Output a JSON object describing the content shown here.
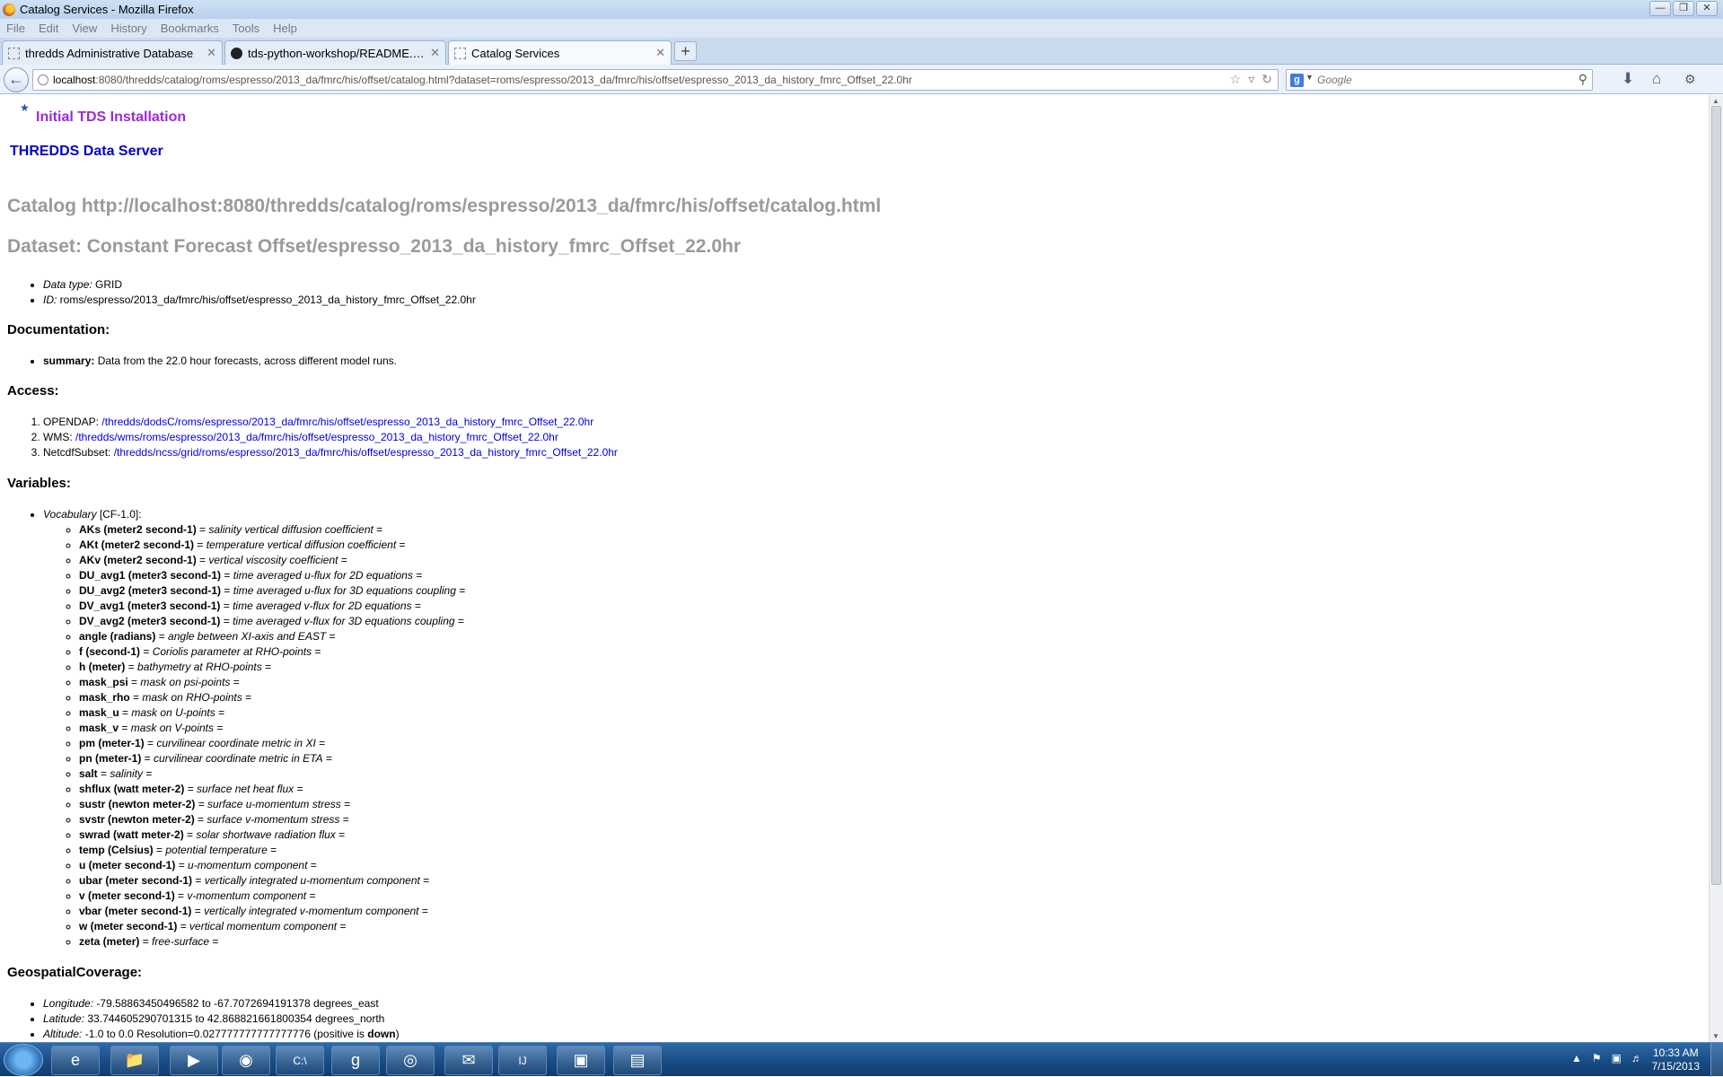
{
  "window": {
    "title": "Catalog Services - Mozilla Firefox",
    "min_icon": "minimize-icon",
    "max_icon": "maximize-icon",
    "close_icon": "close-icon"
  },
  "menu": [
    "File",
    "Edit",
    "View",
    "History",
    "Bookmarks",
    "Tools",
    "Help"
  ],
  "tabs": [
    {
      "label": "thredds Administrative Database",
      "active": false
    },
    {
      "label": "tds-python-workshop/README.org a...",
      "active": false
    },
    {
      "label": "Catalog Services",
      "active": true
    }
  ],
  "new_tab_label": "+",
  "address": {
    "host": "localhost",
    "rest": ":8080/thredds/catalog/roms/espresso/2013_da/fmrc/his/offset/catalog.html?dataset=roms/espresso/2013_da/fmrc/his/offset/espresso_2013_da_history_fmrc_Offset_22.0hr"
  },
  "search": {
    "placeholder": "Google",
    "engine_letter": "g"
  },
  "page": {
    "install_name": "Initial TDS Installation",
    "server_name": "THREDDS Data Server",
    "catalog_title": "Catalog http://localhost:8080/thredds/catalog/roms/espresso/2013_da/fmrc/his/offset/catalog.html",
    "dataset_title": "Dataset: Constant Forecast Offset/espresso_2013_da_history_fmrc_Offset_22.0hr",
    "info": [
      {
        "label": "Data type:",
        "value": " GRID"
      },
      {
        "label": "ID:",
        "value": " roms/espresso/2013_da/fmrc/his/offset/espresso_2013_da_history_fmrc_Offset_22.0hr"
      }
    ],
    "documentation": {
      "heading": "Documentation:",
      "label": "summary:",
      "text": " Data from the 22.0 hour forecasts, across different model runs."
    },
    "access": {
      "heading": "Access:",
      "items": [
        {
          "service": "OPENDAP:",
          "link": "/thredds/dodsC/roms/espresso/2013_da/fmrc/his/offset/espresso_2013_da_history_fmrc_Offset_22.0hr"
        },
        {
          "service": "WMS:",
          "link": "/thredds/wms/roms/espresso/2013_da/fmrc/his/offset/espresso_2013_da_history_fmrc_Offset_22.0hr"
        },
        {
          "service": "NetcdfSubset:",
          "link": "/thredds/ncss/grid/roms/espresso/2013_da/fmrc/his/offset/espresso_2013_da_history_fmrc_Offset_22.0hr"
        }
      ]
    },
    "variables": {
      "heading": "Variables:",
      "vocab_label": "Vocabulary",
      "vocab_value": " [CF-1.0]:",
      "items": [
        {
          "name": "AKs (meter2 second-1)",
          "desc": "salinity vertical diffusion coefficient"
        },
        {
          "name": "AKt (meter2 second-1)",
          "desc": "temperature vertical diffusion coefficient"
        },
        {
          "name": "AKv (meter2 second-1)",
          "desc": "vertical viscosity coefficient"
        },
        {
          "name": "DU_avg1 (meter3 second-1)",
          "desc": "time averaged u-flux for 2D equations"
        },
        {
          "name": "DU_avg2 (meter3 second-1)",
          "desc": "time averaged u-flux for 3D equations coupling"
        },
        {
          "name": "DV_avg1 (meter3 second-1)",
          "desc": "time averaged v-flux for 2D equations"
        },
        {
          "name": "DV_avg2 (meter3 second-1)",
          "desc": "time averaged v-flux for 3D equations coupling"
        },
        {
          "name": "angle (radians)",
          "desc": "angle between XI-axis and EAST"
        },
        {
          "name": "f (second-1)",
          "desc": "Coriolis parameter at RHO-points"
        },
        {
          "name": "h (meter)",
          "desc": "bathymetry at RHO-points"
        },
        {
          "name": "mask_psi",
          "desc": "mask on psi-points"
        },
        {
          "name": "mask_rho",
          "desc": "mask on RHO-points"
        },
        {
          "name": "mask_u",
          "desc": "mask on U-points"
        },
        {
          "name": "mask_v",
          "desc": "mask on V-points"
        },
        {
          "name": "pm (meter-1)",
          "desc": "curvilinear coordinate metric in XI"
        },
        {
          "name": "pn (meter-1)",
          "desc": "curvilinear coordinate metric in ETA"
        },
        {
          "name": "salt",
          "desc": "salinity"
        },
        {
          "name": "shflux (watt meter-2)",
          "desc": "surface net heat flux"
        },
        {
          "name": "sustr (newton meter-2)",
          "desc": "surface u-momentum stress"
        },
        {
          "name": "svstr (newton meter-2)",
          "desc": "surface v-momentum stress"
        },
        {
          "name": "swrad (watt meter-2)",
          "desc": "solar shortwave radiation flux"
        },
        {
          "name": "temp (Celsius)",
          "desc": "potential temperature"
        },
        {
          "name": "u (meter second-1)",
          "desc": "u-momentum component"
        },
        {
          "name": "ubar (meter second-1)",
          "desc": "vertically integrated u-momentum component"
        },
        {
          "name": "v (meter second-1)",
          "desc": "v-momentum component"
        },
        {
          "name": "vbar (meter second-1)",
          "desc": "vertically integrated v-momentum component"
        },
        {
          "name": "w (meter second-1)",
          "desc": "vertical momentum component"
        },
        {
          "name": "zeta (meter)",
          "desc": "free-surface"
        }
      ]
    },
    "geo": {
      "heading": "GeospatialCoverage:",
      "longitude_label": "Longitude:",
      "longitude_value": " -79.58863450496582 to -67.7072694191378 degrees_east",
      "latitude_label": "Latitude:",
      "latitude_value": " 33.744605290701315 to 42.868821661800354 degrees_north",
      "altitude_label": "Altitude:",
      "altitude_value": " -1.0 to 0.0 Resolution=0.027777777777777776 (positive is ",
      "altitude_dir": "down",
      "altitude_close": ")"
    }
  },
  "taskbar": {
    "time": "10:33 AM",
    "date": "7/15/2013",
    "apps": [
      "ie-icon",
      "explorer-icon",
      "media-player-icon",
      "firefox-icon",
      "cmd-icon",
      "git-icon",
      "chrome-icon",
      "thunderbird-icon",
      "intellij-icon",
      "virtualbox-icon",
      "remote-desktop-icon"
    ]
  }
}
